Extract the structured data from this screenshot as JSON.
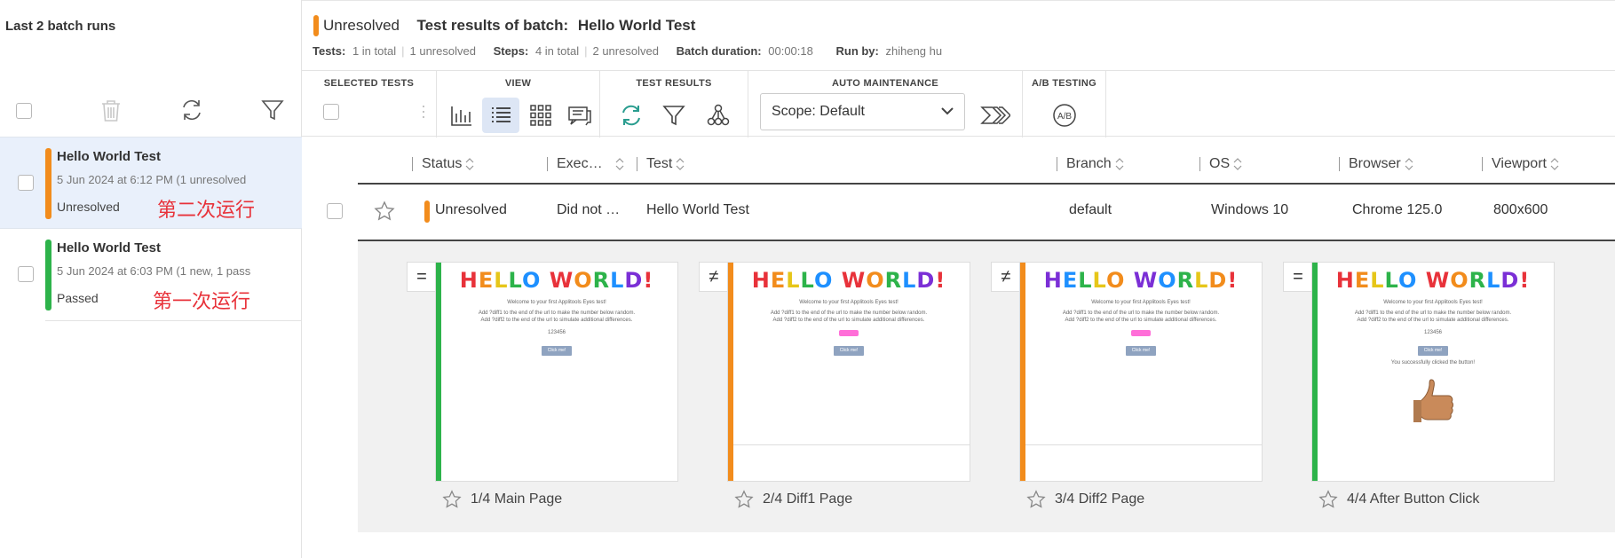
{
  "left_panel": {
    "title": "Last 2 batch runs",
    "batches": [
      {
        "name": "Hello World Test",
        "meta": "5 Jun 2024 at 6:12 PM  (1 unresolved",
        "status": "Unresolved",
        "annotation": "第二次运行",
        "color": "#f28c1c"
      },
      {
        "name": "Hello World Test",
        "meta": "5 Jun 2024 at 6:03 PM  (1 new, 1 pass",
        "status": "Passed",
        "annotation": "第一次运行",
        "color": "#2db34a"
      }
    ]
  },
  "header": {
    "status": "Unresolved",
    "title_prefix": "Test results of batch:",
    "batch_name": "Hello World Test",
    "tests_label": "Tests:",
    "tests_total": "1 in total",
    "tests_unresolved": "1 unresolved",
    "steps_label": "Steps:",
    "steps_total": "4 in total",
    "steps_unresolved": "2 unresolved",
    "duration_label": "Batch duration:",
    "duration": "00:00:18",
    "runby_label": "Run by:",
    "runby": "zhiheng hu"
  },
  "toolbar": {
    "selected_tests": "SELECTED TESTS",
    "view": "VIEW",
    "test_results": "TEST RESULTS",
    "auto_maintenance": "AUTO MAINTENANCE",
    "scope": "Scope: Default",
    "ab_testing": "A/B TESTING",
    "ab_icon_text": "A/B"
  },
  "table": {
    "columns": [
      "Status",
      "Exec…",
      "Test",
      "Branch",
      "OS",
      "Browser",
      "Viewport"
    ],
    "row": {
      "status": "Unresolved",
      "execution": "Did not …",
      "test": "Hello World Test",
      "branch": "default",
      "os": "Windows 10",
      "browser": "Chrome 125.0",
      "viewport": "800x600"
    }
  },
  "steps": [
    {
      "symbol": "=",
      "label": "1/4 Main Page",
      "color": "#2db34a",
      "number": "123456",
      "extra": ""
    },
    {
      "symbol": "≠",
      "label": "2/4 Diff1 Page",
      "color": "#f28c1c",
      "number": "",
      "extra": ""
    },
    {
      "symbol": "≠",
      "label": "3/4 Diff2 Page",
      "color": "#f28c1c",
      "number": "",
      "extra": ""
    },
    {
      "symbol": "=",
      "label": "4/4 After Button Click",
      "color": "#2db34a",
      "number": "123456",
      "extra": "You successfully clicked the button!"
    }
  ],
  "thumb_text": {
    "headline": "HELLO WORLD!",
    "welcome": "Welcome to your first Applitools Eyes test!",
    "line1": "Add ?diff1 to the end of the url to make the number below random.",
    "line2": "Add ?diff2 to the end of the url to simulate additional differences.",
    "button": "Click me!"
  }
}
